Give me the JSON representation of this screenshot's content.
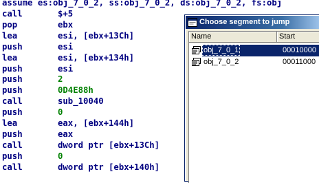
{
  "disassembly": {
    "assume_line": "assume es:obj_7_0_2, ss:obj_7_0_2, ds:obj_7_0_2, fs:obj",
    "lines": [
      {
        "mnemonic": "call",
        "operand": "$+5",
        "operand_kind": "symbol"
      },
      {
        "mnemonic": "pop",
        "operand": "ebx",
        "operand_kind": "symbol"
      },
      {
        "mnemonic": "lea",
        "operand": "esi, [ebx+13Ch]",
        "operand_kind": "symbol"
      },
      {
        "mnemonic": "push",
        "operand": "esi",
        "operand_kind": "symbol"
      },
      {
        "mnemonic": "lea",
        "operand": "esi, [ebx+134h]",
        "operand_kind": "symbol"
      },
      {
        "mnemonic": "push",
        "operand": "esi",
        "operand_kind": "symbol"
      },
      {
        "mnemonic": "push",
        "operand": "2",
        "operand_kind": "number"
      },
      {
        "mnemonic": "push",
        "operand": "0D4E88h",
        "operand_kind": "number"
      },
      {
        "mnemonic": "call",
        "operand": "sub_10040",
        "operand_kind": "symbol"
      },
      {
        "mnemonic": "push",
        "operand": "0",
        "operand_kind": "number"
      },
      {
        "mnemonic": "lea",
        "operand": "eax, [ebx+144h]",
        "operand_kind": "symbol"
      },
      {
        "mnemonic": "push",
        "operand": "eax",
        "operand_kind": "symbol"
      },
      {
        "mnemonic": "call",
        "operand": "dword ptr [ebx+13Ch]",
        "operand_kind": "symbol"
      },
      {
        "mnemonic": "push",
        "operand": "0",
        "operand_kind": "number"
      },
      {
        "mnemonic": "call",
        "operand": "dword ptr [ebx+140h]",
        "operand_kind": "symbol"
      }
    ],
    "colors": {
      "code": "#000080",
      "number": "#008000"
    }
  },
  "dialog": {
    "title": "Choose segment to jump",
    "columns": {
      "name": "Name",
      "start": "Start"
    },
    "rows": [
      {
        "name": "obj_7_0_1",
        "start": "00010000",
        "icon": "segment-icon",
        "selected": true
      },
      {
        "name": "obj_7_0_2",
        "start": "00011000",
        "icon": "segment-icon",
        "selected": false
      }
    ],
    "colors": {
      "title_bar": "#0a246a",
      "selection": "#0a246a"
    }
  }
}
